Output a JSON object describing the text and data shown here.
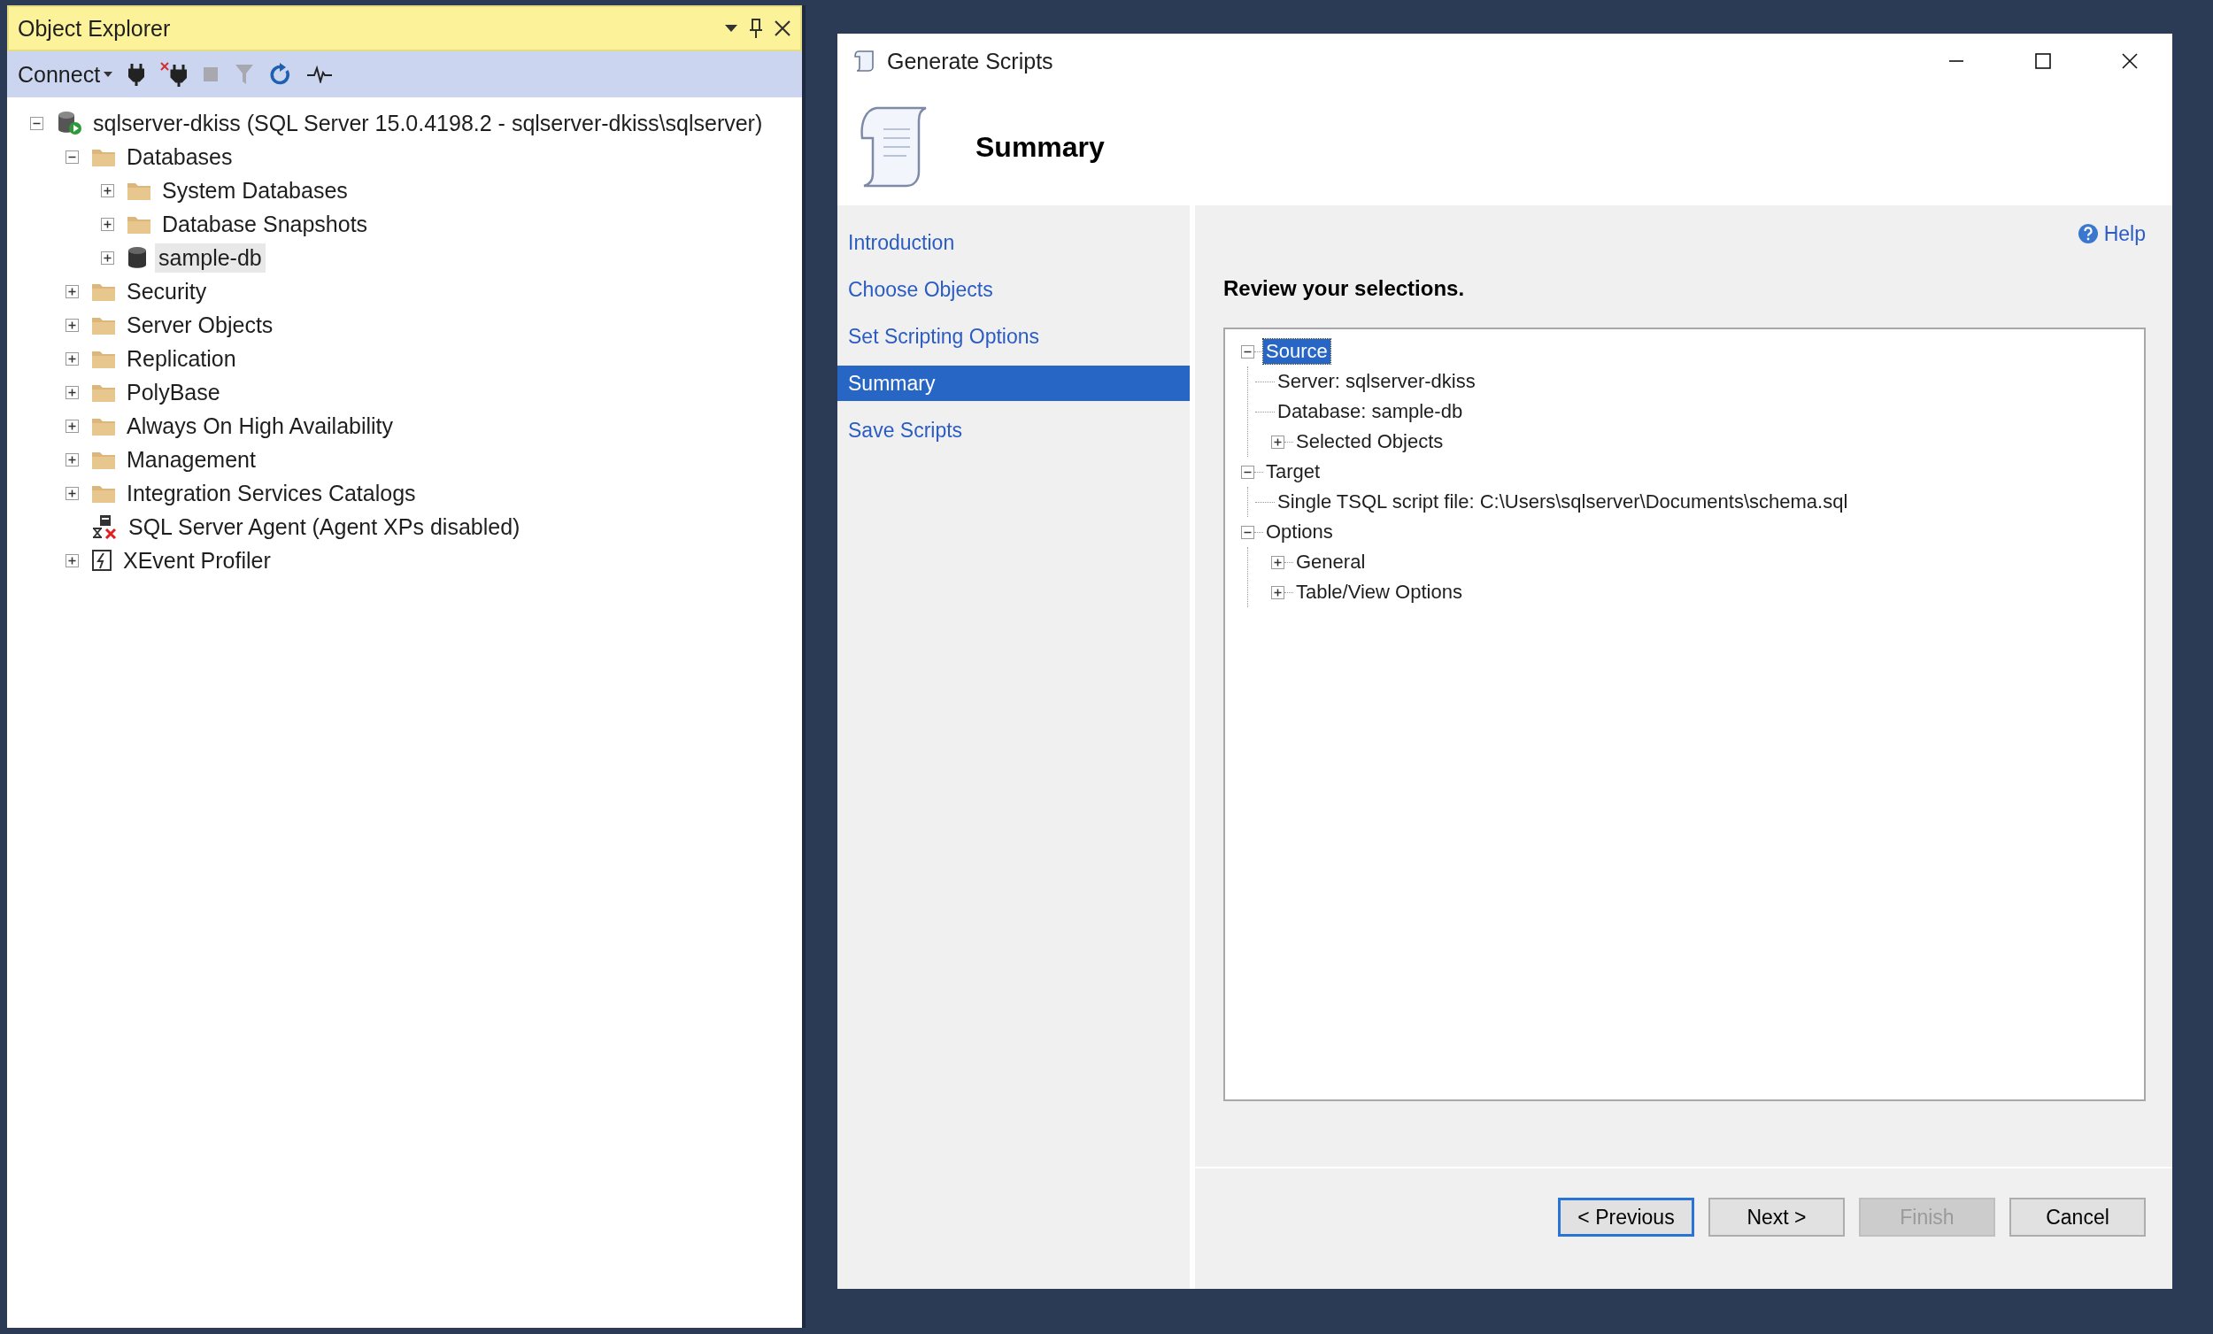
{
  "object_explorer": {
    "title": "Object Explorer",
    "toolbar": {
      "connect_label": "Connect"
    },
    "tree": [
      {
        "label": "sqlserver-dkiss (SQL Server 15.0.4198.2 - sqlserver-dkiss\\sqlserver)",
        "kind": "server",
        "expanded": true,
        "selected": false,
        "children": [
          {
            "label": "Databases",
            "kind": "folder",
            "expanded": true,
            "selected": false,
            "children": [
              {
                "label": "System Databases",
                "kind": "folder",
                "expanded": false,
                "selected": false
              },
              {
                "label": "Database Snapshots",
                "kind": "folder",
                "expanded": false,
                "selected": false
              },
              {
                "label": "sample-db",
                "kind": "database",
                "expanded": false,
                "selected": true
              }
            ]
          },
          {
            "label": "Security",
            "kind": "folder",
            "expanded": false,
            "selected": false
          },
          {
            "label": "Server Objects",
            "kind": "folder",
            "expanded": false,
            "selected": false
          },
          {
            "label": "Replication",
            "kind": "folder",
            "expanded": false,
            "selected": false
          },
          {
            "label": "PolyBase",
            "kind": "folder",
            "expanded": false,
            "selected": false
          },
          {
            "label": "Always On High Availability",
            "kind": "folder",
            "expanded": false,
            "selected": false
          },
          {
            "label": "Management",
            "kind": "folder",
            "expanded": false,
            "selected": false
          },
          {
            "label": "Integration Services Catalogs",
            "kind": "folder",
            "expanded": false,
            "selected": false
          },
          {
            "label": "SQL Server Agent (Agent XPs disabled)",
            "kind": "agent",
            "selected": false
          },
          {
            "label": "XEvent Profiler",
            "kind": "profiler",
            "expanded": false,
            "selected": false
          }
        ]
      }
    ]
  },
  "dialog": {
    "title": "Generate Scripts",
    "heading": "Summary",
    "nav": [
      {
        "label": "Introduction",
        "selected": false
      },
      {
        "label": "Choose Objects",
        "selected": false
      },
      {
        "label": "Set Scripting Options",
        "selected": false
      },
      {
        "label": "Summary",
        "selected": true
      },
      {
        "label": "Save Scripts",
        "selected": false
      }
    ],
    "help": "Help",
    "instruction": "Review your selections.",
    "summary_tree": [
      {
        "label": "Source",
        "expanded": true,
        "selected": true,
        "children": [
          {
            "label": "Server: sqlserver-dkiss",
            "selected": false
          },
          {
            "label": "Database: sample-db",
            "selected": false
          },
          {
            "label": "Selected Objects",
            "expanded": false,
            "selected": false
          }
        ]
      },
      {
        "label": "Target",
        "expanded": true,
        "selected": false,
        "children": [
          {
            "label": "Single TSQL script file: C:\\Users\\sqlserver\\Documents\\schema.sql",
            "selected": false
          }
        ]
      },
      {
        "label": "Options",
        "expanded": true,
        "selected": false,
        "children": [
          {
            "label": "General",
            "expanded": false,
            "selected": false
          },
          {
            "label": "Table/View Options",
            "expanded": false,
            "selected": false
          }
        ]
      }
    ],
    "buttons": [
      {
        "label": "< Previous",
        "focused": true,
        "disabled": false
      },
      {
        "label": "Next >",
        "focused": false,
        "disabled": false
      },
      {
        "label": "Finish",
        "focused": false,
        "disabled": true
      },
      {
        "label": "Cancel",
        "focused": false,
        "disabled": false
      }
    ]
  }
}
